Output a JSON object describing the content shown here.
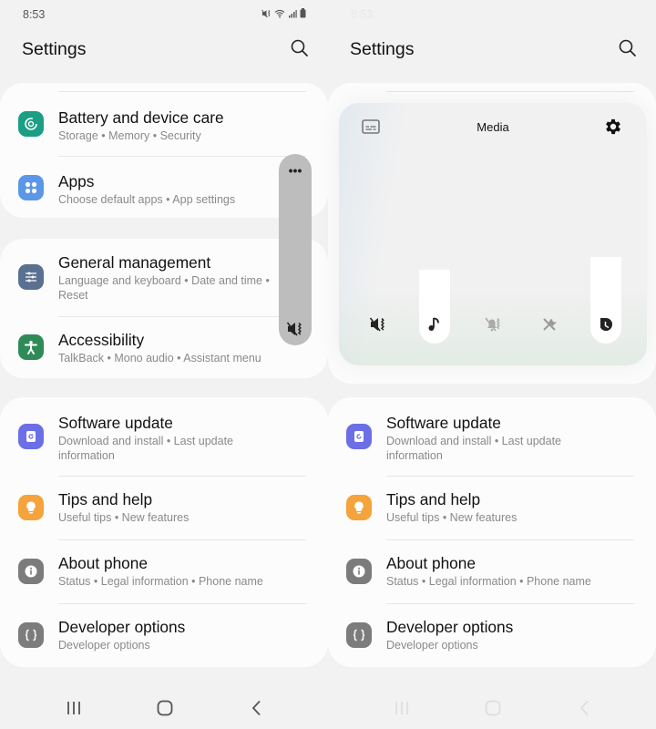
{
  "status_bar": {
    "time": "8:53",
    "icons": [
      "mute-vibrate-icon",
      "wifi-icon",
      "signal-icon",
      "battery-icon"
    ]
  },
  "header": {
    "title": "Settings",
    "search_icon": "search-icon"
  },
  "cards": [
    {
      "items": [
        {
          "title": "Battery and device care",
          "subtitle": "Storage  •  Memory  •  Security",
          "icon": "device-care-icon",
          "color": "#1a9e84"
        },
        {
          "title": "Apps",
          "subtitle": "Choose default apps  •  App settings",
          "icon": "apps-icon",
          "color": "#5b97e6"
        }
      ]
    },
    {
      "items": [
        {
          "title": "General management",
          "subtitle": "Language and keyboard  •  Date and time  •  Reset",
          "icon": "sliders-icon",
          "color": "#5a7090"
        },
        {
          "title": "Accessibility",
          "subtitle": "TalkBack  •  Mono audio  •  Assistant menu",
          "icon": "accessibility-icon",
          "color": "#2e8b57"
        }
      ]
    },
    {
      "items": [
        {
          "title": "Software update",
          "subtitle": "Download and install  •  Last update information",
          "icon": "software-update-icon",
          "color": "#6c6ee6"
        },
        {
          "title": "Tips and help",
          "subtitle": "Useful tips  •  New features",
          "icon": "lightbulb-icon",
          "color": "#f5a33c"
        },
        {
          "title": "About phone",
          "subtitle": "Status  •  Legal information  •  Phone name",
          "icon": "info-icon",
          "color": "#7c7c7c"
        },
        {
          "title": "Developer options",
          "subtitle": "Developer options",
          "icon": "braces-icon",
          "color": "#7c7c7c"
        }
      ]
    }
  ],
  "volume_collapsed": {
    "more_label": "•••",
    "mode_icon": "mute-vibrate-icon"
  },
  "volume_expanded": {
    "title": "Media",
    "captions_icon": "live-caption-icon",
    "settings_icon": "gear-icon",
    "sliders": [
      {
        "name": "ringtone",
        "icon": "mute-vibrate-icon",
        "level": 0.0
      },
      {
        "name": "media",
        "icon": "music-note-icon",
        "level": 0.41
      },
      {
        "name": "notifications",
        "icon": "notification-off-icon",
        "level": 0.0
      },
      {
        "name": "system",
        "icon": "system-off-icon",
        "level": 0.0
      },
      {
        "name": "bixby",
        "icon": "bixby-icon",
        "level": 0.48
      }
    ]
  },
  "nav_bar": {
    "buttons": [
      "recents-icon",
      "home-icon",
      "back-icon"
    ]
  },
  "colors": {
    "background": "#f2f2f2",
    "card": "#fcfcfc",
    "volume_pill": "#bdbdbd",
    "subtitle": "#8a8a8a"
  }
}
